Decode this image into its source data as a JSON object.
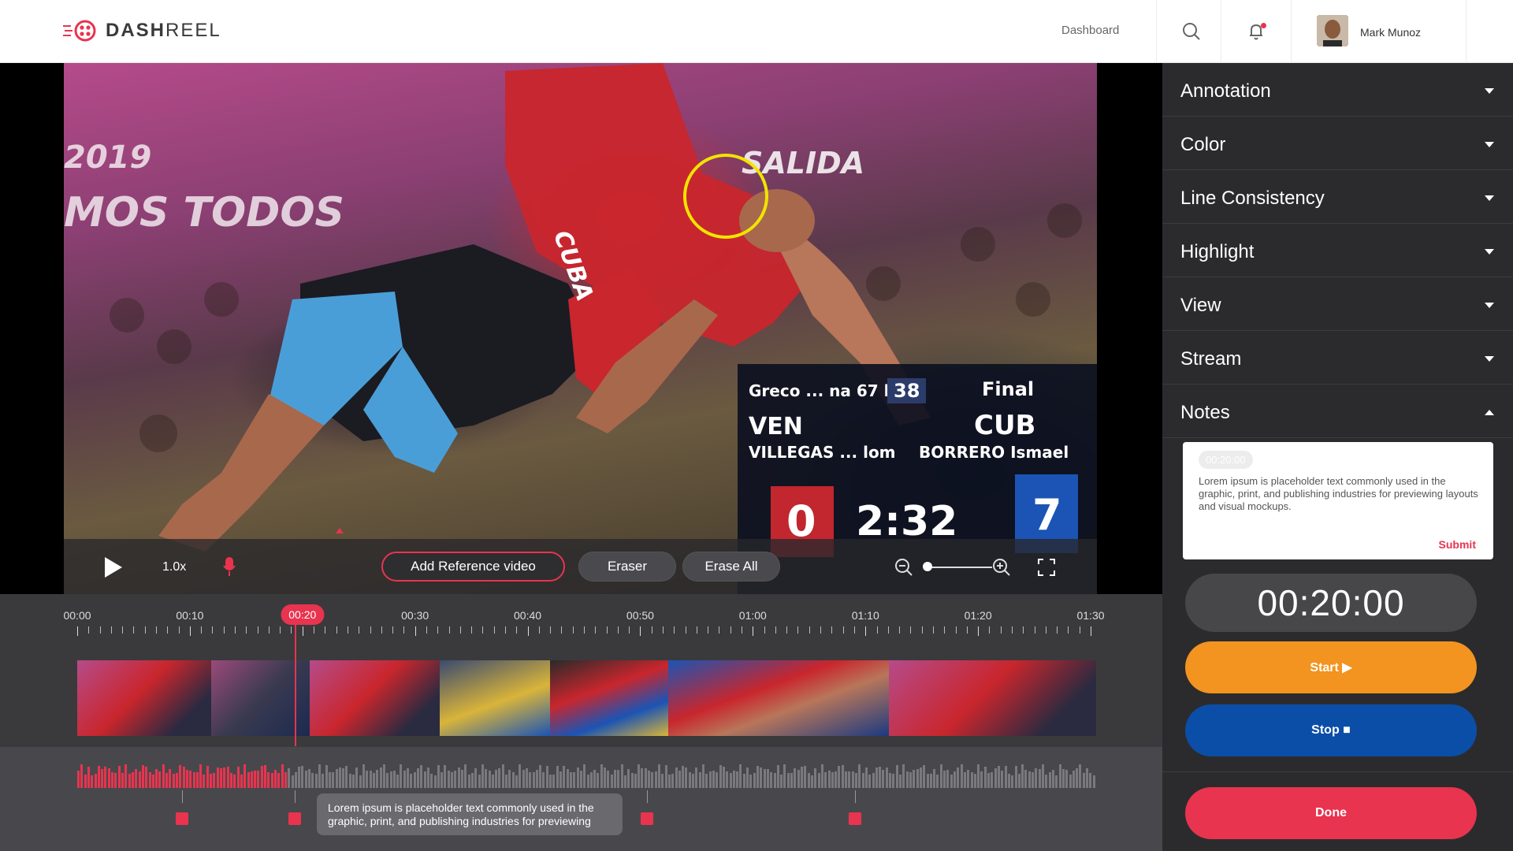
{
  "header": {
    "logo_bold": "DASH",
    "logo_light": "REEL",
    "nav_dashboard": "Dashboard",
    "user_name": "Mark Munoz"
  },
  "video": {
    "speed": "1.0x",
    "add_reference_label": "Add Reference video",
    "eraser_label": "Eraser",
    "erase_all_label": "Erase All",
    "zoom_level": 0.1,
    "scene_text": {
      "year": "2019",
      "banner": "MOS TODOS",
      "salida": "SALIDA",
      "jersey": "CUBA"
    },
    "scoreboard": {
      "category": "Greco ... na 67 kg",
      "number": "38",
      "stage": "Final",
      "left_country": "VEN",
      "left_name": "VILLEGAS ... lom",
      "right_country": "CUB",
      "right_name": "BORRERO Ismael",
      "left_score": "0",
      "clock": "2:32",
      "right_score": "7"
    }
  },
  "timeline": {
    "labels": [
      "00:00",
      "00:10",
      "00:20",
      "00:30",
      "00:40",
      "00:50",
      "01:00",
      "01:10",
      "01:20",
      "01:30"
    ],
    "current_label": "00:20",
    "played_fraction": 0.205,
    "tooltip": "Lorem ipsum is placeholder text commonly used in the graphic, print, and publishing industries for previewing"
  },
  "panel": {
    "sections": [
      "Annotation",
      "Color",
      "Line Consistency",
      "Highlight",
      "View",
      "Stream",
      "Notes"
    ],
    "notes": {
      "time": "00:20:00",
      "body": "Lorem ipsum is placeholder text commonly used in the graphic, print, and publishing industries for previewing layouts and visual mockups.",
      "submit_label": "Submit"
    },
    "timer": "00:20:00",
    "start_label": "Start ▶",
    "stop_label": "Stop ■",
    "done_label": "Done"
  },
  "colors": {
    "accent": "#e8344f",
    "start": "#f2941f",
    "stop": "#0b4ea8",
    "annotation_circle": "#f0e400"
  },
  "icons": [
    "logo-icon",
    "search-icon",
    "bell-icon",
    "play-icon",
    "mic-icon",
    "zoom-out-icon",
    "zoom-in-icon",
    "fullscreen-icon"
  ]
}
